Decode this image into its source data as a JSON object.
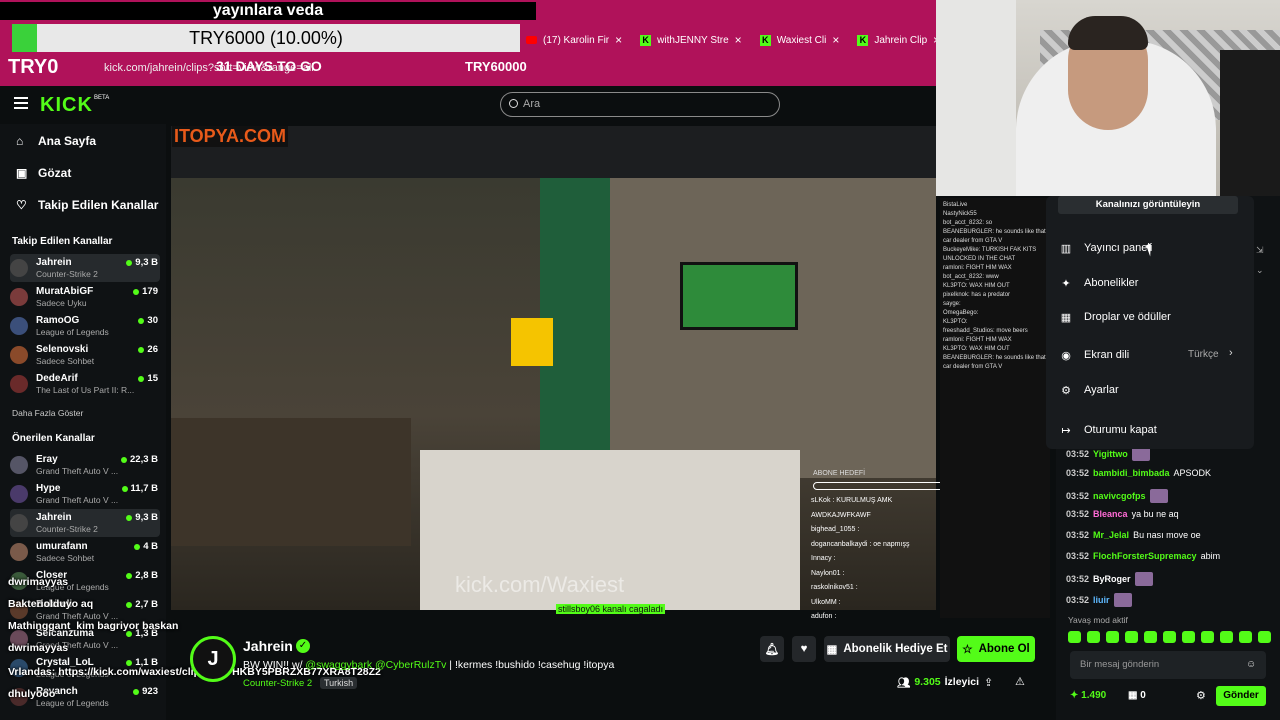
{
  "overlay_top": {
    "caption": "yayınlara veda",
    "goal_text": "TRY6000 (10.00%)",
    "goal_progress": 0.1,
    "left_amount": "TRY0",
    "days": "31 DAYS TO GO",
    "right_amount": "TRY60000"
  },
  "browser": {
    "tabs": [
      {
        "label": "(17) Karolin Fir",
        "icon": "youtube-icon"
      },
      {
        "label": "withJENNY Stre",
        "icon": "kick-icon"
      },
      {
        "label": "Waxiest Cli",
        "icon": "kick-icon"
      },
      {
        "label": "Jahrein Clip",
        "icon": "kick-icon"
      }
    ],
    "url": "kick.com/jahrein/clips?sort=view&range=all"
  },
  "header": {
    "logo": "KICK",
    "beta": "BETA",
    "search_placeholder": "Ara"
  },
  "nav": {
    "home": "Ana Sayfa",
    "browse": "Gözat",
    "following": "Takip Edilen Kanallar"
  },
  "followed": {
    "title": "Takip Edilen Kanallar",
    "items": [
      {
        "name": "Jahrein",
        "game": "Counter-Strike 2",
        "viewers": "9,3 B",
        "color": "#444"
      },
      {
        "name": "MuratAbiGF",
        "game": "Sadece Uyku",
        "viewers": "179",
        "color": "#7a3b3b"
      },
      {
        "name": "RamoOG",
        "game": "League of Legends",
        "viewers": "30",
        "color": "#3b4f7a"
      },
      {
        "name": "Selenovski",
        "game": "Sadece Sohbet",
        "viewers": "26",
        "color": "#8a4a2a"
      },
      {
        "name": "DedeArif",
        "game": "The Last of Us Part II: R...",
        "viewers": "15",
        "color": "#6a2a2a"
      }
    ],
    "more": "Daha Fazla Göster"
  },
  "recommended": {
    "title": "Önerilen Kanallar",
    "items": [
      {
        "name": "Eray",
        "game": "Grand Theft Auto V ...",
        "viewers": "22,3 B",
        "color": "#556"
      },
      {
        "name": "Hype",
        "game": "Grand Theft Auto V ...",
        "viewers": "11,7 B",
        "color": "#4a3a6a"
      },
      {
        "name": "Jahrein",
        "game": "Counter-Strike 2",
        "viewers": "9,3 B",
        "color": "#444"
      },
      {
        "name": "umurafann",
        "game": "Sadece Sohbet",
        "viewers": "4 B",
        "color": "#7a5a4a"
      },
      {
        "name": "Closer",
        "game": "League of Legends",
        "viewers": "2,8 B",
        "color": "#3a5a3a"
      },
      {
        "name": "Bakireli",
        "game": "Grand Theft Auto V ...",
        "viewers": "2,7 B",
        "color": "#5a3a2a"
      },
      {
        "name": "Selcanzuma",
        "game": "Grand Theft Auto V ...",
        "viewers": "1,3 B",
        "color": "#6a4a5a"
      },
      {
        "name": "Crystal_LoL",
        "game": "League of Legends",
        "viewers": "1,1 B",
        "color": "#2a4a6a"
      },
      {
        "name": "Revanch",
        "game": "League of Legends",
        "viewers": "923",
        "color": "#4a2a2a"
      }
    ]
  },
  "sidebar_overlay_chat": [
    "dwrimayyas",
    "Bakteriolduyo aq",
    "Mathinggant_kim bagriyor baskan",
    "dwrimayyas",
    "Vrlandas: https://kick.com/waxiest/clip_01KPHKBY5PBRZXB77XRA8T28Z2",
    "dhulyooo"
  ],
  "video": {
    "inner_logo": "ITOPYA.COM",
    "watermark": "kick.com/Waxiest",
    "clip_user": "stillsboy06 kanalı cagaladı",
    "goal_label": "ABONE HEDEFİ",
    "chat_lines": [
      "sLKok : KURULMUŞ AMK AWDKAJWFKAWF",
      "bighead_1055 :",
      "dogancanbalkaydi : oe napmışş",
      "Innacy :",
      "Naylon01 :",
      "raskolnikov51 :",
      "UlkoMM :",
      "adufon :"
    ],
    "overlay_chat": [
      "BistaLive",
      "NastyNick55",
      "bot_acct_8232: so",
      "BEANEBURGLER: he sounds like that car dealer from GTA V",
      "BuckeyeMike: TURKISH FAK KITS UNLOCKED IN THE CHAT",
      "ramloni: FIGHT HIM WAX",
      "bot_acct_8232: www",
      "KL3PTO: WAX HIM OUT",
      "pixelknok: has a predator",
      "sayge:",
      "OmegaBego:",
      "KL3PTO:",
      "freeshadd_Studios: move beers",
      "ramloni: FIGHT HIM WAX",
      "KL3PTO: WAX HIM OUT",
      "BEANEBURGLER: he sounds like that car dealer from GTA V"
    ]
  },
  "streamer": {
    "name": "Jahrein",
    "title_prefix": "BW WIN!! w/",
    "title_tags": "@swaggybark @CyberRulzTv",
    "title_suffix": "| !kermes !bushido !casehug !itopya",
    "category": "Counter-Strike 2",
    "language": "Turkish",
    "gift_button": "Abonelik Hediye Et",
    "sub_button": "Abone Ol",
    "viewers": "9.305",
    "viewers_label": "İzleyici"
  },
  "dropdown": {
    "header": "Kanalınızı görüntüleyin",
    "items": [
      {
        "label": "Yayıncı paneli",
        "icon": "dashboard-icon"
      },
      {
        "label": "Abonelikler",
        "icon": "sparkle-icon"
      },
      {
        "label": "Droplar ve ödüller",
        "icon": "gift-icon"
      },
      {
        "label": "Ekran dili",
        "icon": "globe-icon"
      },
      {
        "label": "Ayarlar",
        "icon": "gear-icon"
      },
      {
        "label": "Oturumu kapat",
        "icon": "logout-icon"
      }
    ],
    "language_value": "Türkçe"
  },
  "chat": {
    "messages": [
      {
        "time": "03:52",
        "user": "Yigittwo",
        "text": "",
        "color": "#53fc18"
      },
      {
        "time": "03:52",
        "user": "bambidi_bimbada",
        "text": "APSODK",
        "color": "#53fc18"
      },
      {
        "time": "03:52",
        "user": "navivcgofps",
        "text": "",
        "color": "#53fc18"
      },
      {
        "time": "03:52",
        "user": "Bleanca",
        "text": "ya bu ne aq",
        "color": "#ff6bd6"
      },
      {
        "time": "03:52",
        "user": "Mr_Jelal",
        "text": "Bu nası move oe",
        "color": "#53fc18"
      },
      {
        "time": "03:52",
        "user": "FlochForsterSupremacy",
        "text": "abim",
        "color": "#53fc18"
      },
      {
        "time": "03:52",
        "user": "ByRoger",
        "text": "",
        "color": "#ffffff"
      },
      {
        "time": "03:52",
        "user": "liuir",
        "text": "",
        "color": "#5eb8ff"
      }
    ],
    "slow_mode": "Yavaş mod aktif",
    "input_placeholder": "Bir mesaj gönderin",
    "points": "1.490",
    "gifts": "0",
    "send": "Gönder"
  }
}
